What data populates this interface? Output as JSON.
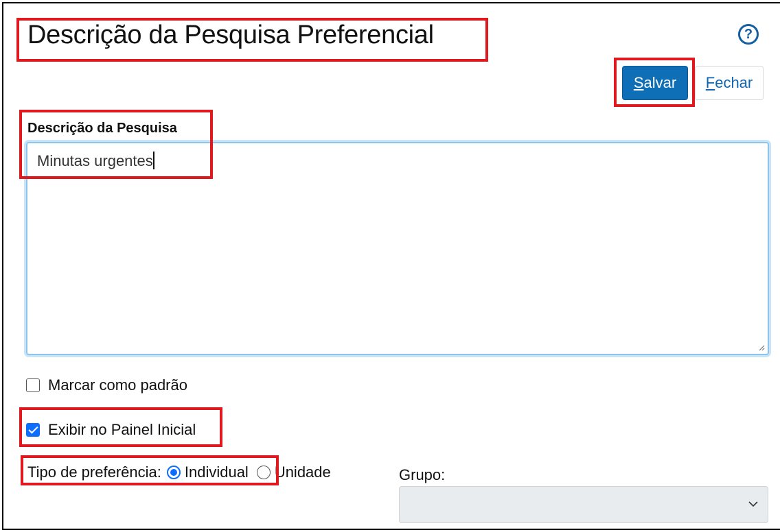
{
  "dialog": {
    "title": "Descrição da Pesquisa Preferencial",
    "help_icon": "question-circle-icon",
    "help_glyph": "?"
  },
  "toolbar": {
    "save_accesskey": "S",
    "save_rest": "alvar",
    "close_accesskey": "F",
    "close_rest": "echar"
  },
  "form": {
    "description_label": "Descrição da Pesquisa",
    "description_value": "Minutas urgentes",
    "mark_default_label": "Marcar como padrão",
    "mark_default_checked": false,
    "show_dashboard_label": "Exibir no Painel Inicial",
    "show_dashboard_checked": true,
    "preference_type_label": "Tipo de preferência:",
    "preference_options": [
      {
        "label": "Individual",
        "selected": true
      },
      {
        "label": "Unidade",
        "selected": false
      }
    ],
    "group_label": "Grupo:",
    "group_value": ""
  },
  "colors": {
    "primary": "#0f6fb6",
    "highlight": "#e0191f",
    "checkbox_checked": "#0d6efd"
  }
}
